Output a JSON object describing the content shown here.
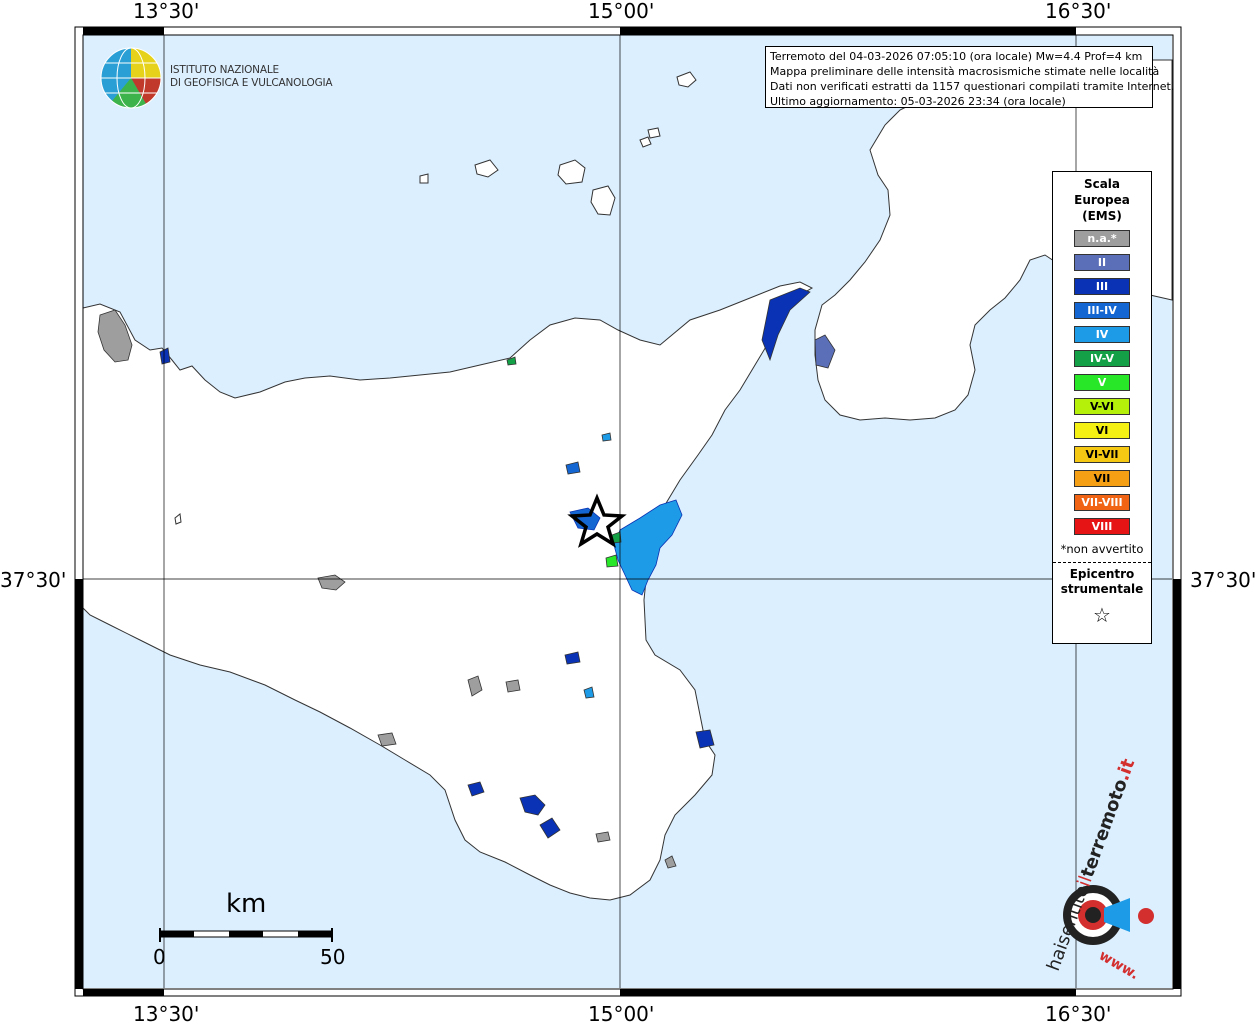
{
  "coordinate_labels": {
    "lon_left": "13°30'",
    "lon_center": "15°00'",
    "lon_right": "16°30'",
    "lat": "37°30'"
  },
  "institute": {
    "line1": "ISTITUTO NAZIONALE",
    "line2": "DI GEOFISICA E VULCANOLOGIA"
  },
  "info": {
    "line1": "Terremoto del 04-03-2026 07:05:10 (ora locale) Mw=4.4 Prof=4 km",
    "line2": "Mappa preliminare delle intensità macrosismiche stimate nelle località",
    "line3": "Dati non verificati estratti da 1157 questionari compilati tramite Internet.",
    "line4": "Ultimo aggiornamento: 05-03-2026 23:34 (ora locale)"
  },
  "legend": {
    "title1": "Scala",
    "title2": "Europea",
    "title3": "(EMS)",
    "items": [
      {
        "label": "n.a.*",
        "color": "#9e9e9e"
      },
      {
        "label": "II",
        "color": "#5a6fb8"
      },
      {
        "label": "III",
        "color": "#0a32b4"
      },
      {
        "label": "III-IV",
        "color": "#1466d2"
      },
      {
        "label": "IV",
        "color": "#1e9be6"
      },
      {
        "label": "IV-V",
        "color": "#14a046"
      },
      {
        "label": "V",
        "color": "#28e628"
      },
      {
        "label": "V-VI",
        "color": "#b4f00a"
      },
      {
        "label": "VI",
        "color": "#f5f014"
      },
      {
        "label": "VI-VII",
        "color": "#f5c814"
      },
      {
        "label": "VII",
        "color": "#f5a014"
      },
      {
        "label": "VII-VIII",
        "color": "#f06414"
      },
      {
        "label": "VIII",
        "color": "#e61414"
      }
    ],
    "note": "*non avvertito",
    "epi1": "Epicentro",
    "epi2": "strumentale",
    "epi_symbol": "☆"
  },
  "scale_bar": {
    "title": "km",
    "min": "0",
    "max": "50"
  },
  "brand": {
    "name": "haisentitoilterremoto.it",
    "part1": "haisentito",
    "part2": "il",
    "part3": "terremoto",
    "part4": ".it",
    "url_prefix": "www."
  },
  "colors": {
    "sea": "#dcefff",
    "land": "#ffffff",
    "frame": "#000000"
  }
}
